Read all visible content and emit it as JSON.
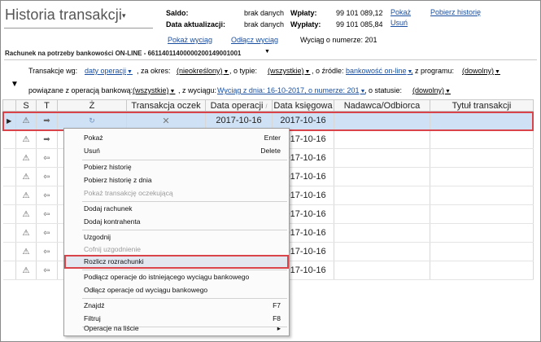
{
  "header": {
    "title": "Historia transakcji",
    "title_caret": "▾",
    "saldo_label": "Saldo:",
    "saldo_value": "brak danych",
    "data_akt_label": "Data aktualizacji:",
    "data_akt_value": "brak danych",
    "wplaty_label": "Wpłaty:",
    "wplaty_value": "99 101 089,12",
    "wyplaty_label": "Wypłaty:",
    "wyplaty_value": "99 101 085,84",
    "pokaz_link": "Pokaż",
    "usun_link": "Usuń",
    "pobierz_historie_link": "Pobierz historię",
    "pokaz_wyciag": "Pokaż wyciąg",
    "odlacz_wyciag": "Odłącz wyciąg",
    "wyciag_numer": "Wyciąg o numerze: 201",
    "account": "Rachunek na potrzeby bankowości ON-LINE - 66114011400000200149001001"
  },
  "filters": {
    "transakcje_wg_label": "Transakcje wg:",
    "transakcje_wg_value": "daty operacji",
    "za_okres_label": ", za okres:",
    "za_okres_value": "(nieokreślony)",
    "o_typie_label": ", o typie:",
    "o_typie_value": "(wszystkie)",
    "o_zrodle_label": ", o źródle:",
    "o_zrodle_value": "bankowość on-line",
    "z_programu_label": ", z programu:",
    "z_programu_value": "(dowolny)",
    "powiazane_label": "powiązane z operacją bankową:",
    "powiazane_value": "(wszystkie)",
    "z_wyciagu_label": ", z wyciągu:",
    "z_wyciagu_value": "Wyciąg z dnia: 16-10-2017, o numerze: 201",
    "o_statusie_label": ", o statusie:",
    "o_statusie_value": "(dowolny)"
  },
  "grid": {
    "columns": [
      "",
      "S",
      "T",
      "Ż",
      "Transakcja oczek",
      "Data operacji",
      "Data księgowa",
      "Nadawca/Odbiorca",
      "Tytuł transakcji"
    ],
    "rows": [
      {
        "marker": "▶",
        "s": "⚠",
        "t": "➡",
        "z": "↻",
        "tx": "✕",
        "date_op": "2017-10-16",
        "date_ks": "2017-10-16"
      },
      {
        "marker": "",
        "s": "⚠",
        "t": "➡",
        "z": "",
        "tx": "",
        "date_op": "",
        "date_ks": "2017-10-16"
      },
      {
        "marker": "",
        "s": "⚠",
        "t": "⇦",
        "z": "",
        "tx": "",
        "date_op": "",
        "date_ks": "2017-10-16"
      },
      {
        "marker": "",
        "s": "⚠",
        "t": "⇦",
        "z": "",
        "tx": "",
        "date_op": "",
        "date_ks": "2017-10-16"
      },
      {
        "marker": "",
        "s": "⚠",
        "t": "⇦",
        "z": "",
        "tx": "",
        "date_op": "",
        "date_ks": "2017-10-16"
      },
      {
        "marker": "",
        "s": "⚠",
        "t": "⇦",
        "z": "",
        "tx": "",
        "date_op": "",
        "date_ks": "2017-10-16"
      },
      {
        "marker": "",
        "s": "⚠",
        "t": "⇦",
        "z": "",
        "tx": "",
        "date_op": "",
        "date_ks": "2017-10-16"
      },
      {
        "marker": "",
        "s": "⚠",
        "t": "⇦",
        "z": "",
        "tx": "",
        "date_op": "",
        "date_ks": "2017-10-16"
      },
      {
        "marker": "",
        "s": "⚠",
        "t": "⇦",
        "z": "",
        "tx": "",
        "date_op": "",
        "date_ks": "2017-10-16"
      }
    ]
  },
  "context_menu": {
    "pokaz": "Pokaż",
    "pokaz_sc": "Enter",
    "usun": "Usuń",
    "usun_sc": "Delete",
    "pobierz_historie": "Pobierz historię",
    "pobierz_historie_dnia": "Pobierz historię z dnia",
    "pokaz_oczekujaca": "Pokaż transakcję oczekującą",
    "dodaj_rachunek": "Dodaj rachunek",
    "dodaj_kontrahenta": "Dodaj kontrahenta",
    "uzgodnij": "Uzgodnij",
    "cofnij_uzgodnienie": "Cofnij uzgodnienie",
    "rozlicz": "Rozlicz rozrachunki",
    "podlacz": "Podłącz operacje do istniejącego wyciągu bankowego",
    "odlacz": "Odłącz operacje od wyciągu bankowego",
    "znajdz": "Znajdź",
    "znajdz_sc": "F7",
    "filtruj": "Filtruj",
    "filtruj_sc": "F8",
    "operacje": "Operacje na liście",
    "operacje_arrow": "▸"
  },
  "colors": {
    "selected_row": "#cfe1f5",
    "highlight_border": "#d9434a",
    "link": "#1a4fa0"
  }
}
